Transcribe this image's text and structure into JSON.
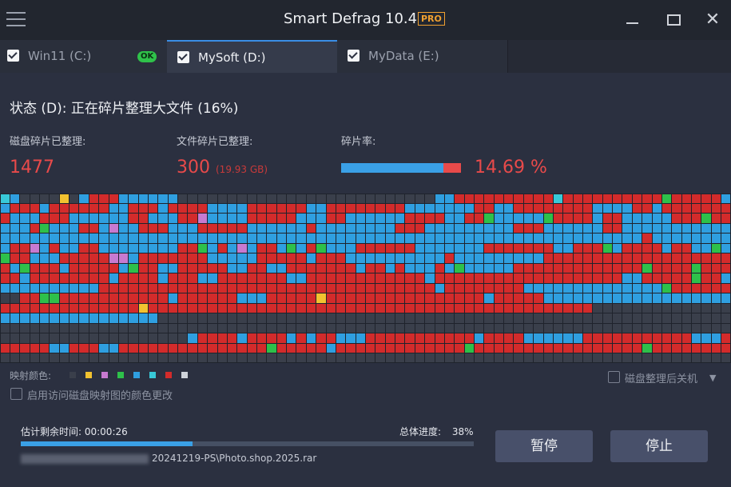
{
  "app": {
    "title": "Smart Defrag 10.4",
    "badge": "PRO"
  },
  "window": {
    "close_glyph": "✕"
  },
  "tabs": [
    {
      "label": "Win11 (C:)",
      "checked": true,
      "badge": "OK"
    },
    {
      "label": "MySoft (D:)",
      "checked": true,
      "active": true,
      "icon": "gear-icon"
    },
    {
      "label": "MyData (E:)",
      "checked": true
    }
  ],
  "status": {
    "text": "状态 (D): 正在碎片整理大文件 (16%)"
  },
  "stats": {
    "disk_label": "磁盘碎片已整理:",
    "disk_value": "1477",
    "file_label": "文件碎片已整理:",
    "file_value": "300",
    "file_size": "(19.93 GB)",
    "frag_label": "碎片率:",
    "frag_rate": "14.69 %",
    "frag_fraction": 0.1469
  },
  "disk_map": {
    "columns": 74,
    "rows": 17,
    "colors": {
      "D": "#3a3f4b",
      "B": "#2f9fe0",
      "R": "#d32b2b",
      "G": "#2ec04a",
      "Y": "#f2c230",
      "C": "#38c9d8",
      "P": "#c77ad0",
      "W": "#cfd3da"
    },
    "rows_data": [
      "CBDDDDYDBRRRBBBBBBDDDDDDDDDDDDDDDDDDDDDDDDDDBBRRRRRRRRRRCRRRRRRRRRRGRRRRRB",
      "BRRRBRRRRRRBBRRRBRRRRBBBBRRRRRRBBRRRRRRRRBBBBBBBRRBBRRRRRRRRBBBBRRBRRRRRRR",
      "RBBBRRRBBBBBBRRBBBRRPBBBBRRRRRBBBRRBBBBBBRRRRBBRRGBBBBBGRRRRBRRBBBBBRRRGRR",
      "BBBRGBBBRRBPBBRRRBBBRRRRRBBBBBBRBBBBBBBBRRRBBBBBBBBBRRRBBBBBBRRBBBBBBBBBBB",
      "BBBBBBBBBBBBBBBBBBBBBBBBBBBBBBBBBBBBBBBBBBBBBBBBBBBBBBBBBBBBBBBBBRBBBBBBBB",
      "BRRPBRBBRRBBBBBBBBRRGBRBPBRRBGBRGBBBRRRRRRBBBBBBBRRRRRRRBBRRRGBRRRRBRRBBGB",
      "GRRBBBRRRRRPPBRRRRRRRBBBBBRRRRRBRRRBBBBBBBBBBRBBBBBBBBBRRRRRRRRRRRRRRRRRRR",
      "RBGRRRBRRRRRBGRRBBRRRRRBBRRBBRRRRRRRBRRBRBBBRBGBBBBBRRRRRRRRRRRRRGRRRRGRRR",
      "RRBRRRRRRRRBRRRRBRRRBBRRRRRRRBBRRRRRRRRRRRRBRRRRRRRRRRRRRRRRRRRBBRRRRRGRRB",
      "BBBBBBBBBBRRRRRRRRRRRRRRRRRRRRRRRRRRRRRRRRRRBRRRRRRRRBBBBBBBBBBBBBBGRRRRRR",
      "DDRRGGRRRRRRRRRRRBRRRRRRBBBRRRRRYRRRRRRRRRRRRRRRRBRRRRRBBBBBBBBBBBBBBBBBBB",
      "RRRRRRRRRRRRRRYRRRRRRRRRRRRRRRRRRRRRRRRRRRRRRRRRRRRRRRRRRRRRDDDDDDDDDDDDDD",
      "BBBBBBBBBBBBBBBBDDDDDDDDDDDDDDDDDDDDDDDDDDDDDDDDDDDDDDDDDDDDDDDDDDDDDDDDDD",
      "DDDDDDDDDDDDDDDDDDDDDDDDDDDDDDDDDDDDDDDDDDDDDDDDDDDDDDDDDDDDDDDDDDDDDDDDDD",
      "DDDDDDDDDDDDDDDDDDDBRRRRBRRRRBRBRRBBBRRRRRRRRRRRBRRRRBBBBBBRRRRRRRRRRRBBBR",
      "RRRRRBBRRRBBRRRRRRRRRRRRRRRGRRRRRBRRRRRRRRRRRRRGRRRRRRRRRRRRRRRRRGRRRRRRRR",
      "DDDDDDDDDDDDDDDDDDDDDDDDDDDDDDDDDDDDDDDDDDDDDDDDDDDDDDDDDDDDDDDDDDDDDDDDDD"
    ]
  },
  "legend": {
    "label": "映射颜色:",
    "colors": [
      "#3a3f4b",
      "#f2c230",
      "#c77ad0",
      "#2ec04a",
      "#2f9fe0",
      "#38c9d8",
      "#d32b2b",
      "#cfd3da"
    ]
  },
  "options": {
    "enable_color_change": "启用访问磁盘映射图的颜色更改",
    "shutdown_after": "磁盘整理后关机"
  },
  "progress": {
    "time_remaining": "估计剩余时间: 00:00:26",
    "overall_label": "总体进度:",
    "overall_value": "38%",
    "fraction": 0.38,
    "current_file": "20241219-PS\\Photo.shop.2025.rar"
  },
  "buttons": {
    "pause": "暂停",
    "stop": "停止"
  }
}
